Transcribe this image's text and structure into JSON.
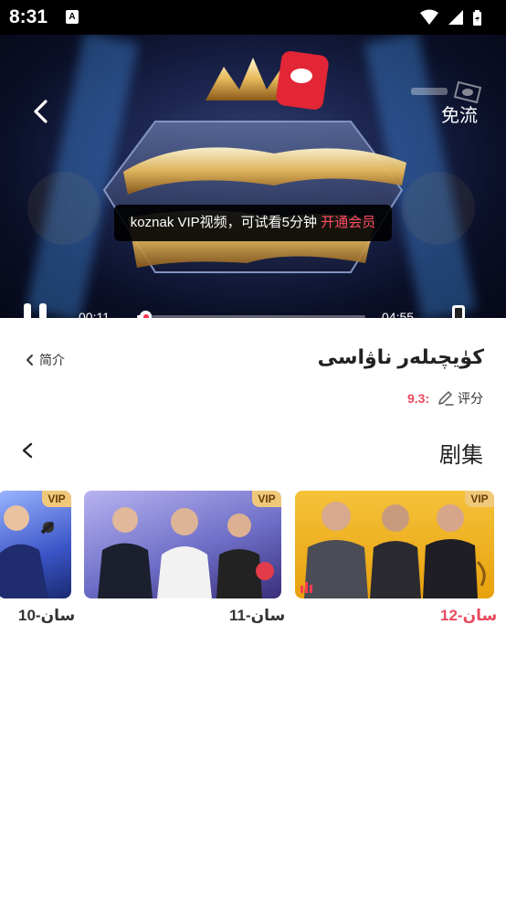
{
  "status_bar": {
    "time": "8:31",
    "badge": "A"
  },
  "player": {
    "free_label": "免流",
    "toast_text": "koznak VIP视频，可试看5分钟",
    "toast_link": "开通会员",
    "current_time": "00:11",
    "total_time": "04:55",
    "progress": 0.037
  },
  "info": {
    "title": "كۈيچىلەر ناۋاسى",
    "intro_label": "简介",
    "rating_score": "9.3:",
    "rating_label": "评分"
  },
  "episodes": {
    "header": "剧集",
    "items": [
      {
        "label": "10-سان",
        "badge": "VIP",
        "active": false
      },
      {
        "label": "11-سان",
        "badge": "VIP",
        "active": false
      },
      {
        "label": "12-سان",
        "badge": "VIP",
        "active": true
      }
    ]
  },
  "colors": {
    "accent": "#e84a5f",
    "vip_badge": "#f0c87a"
  }
}
